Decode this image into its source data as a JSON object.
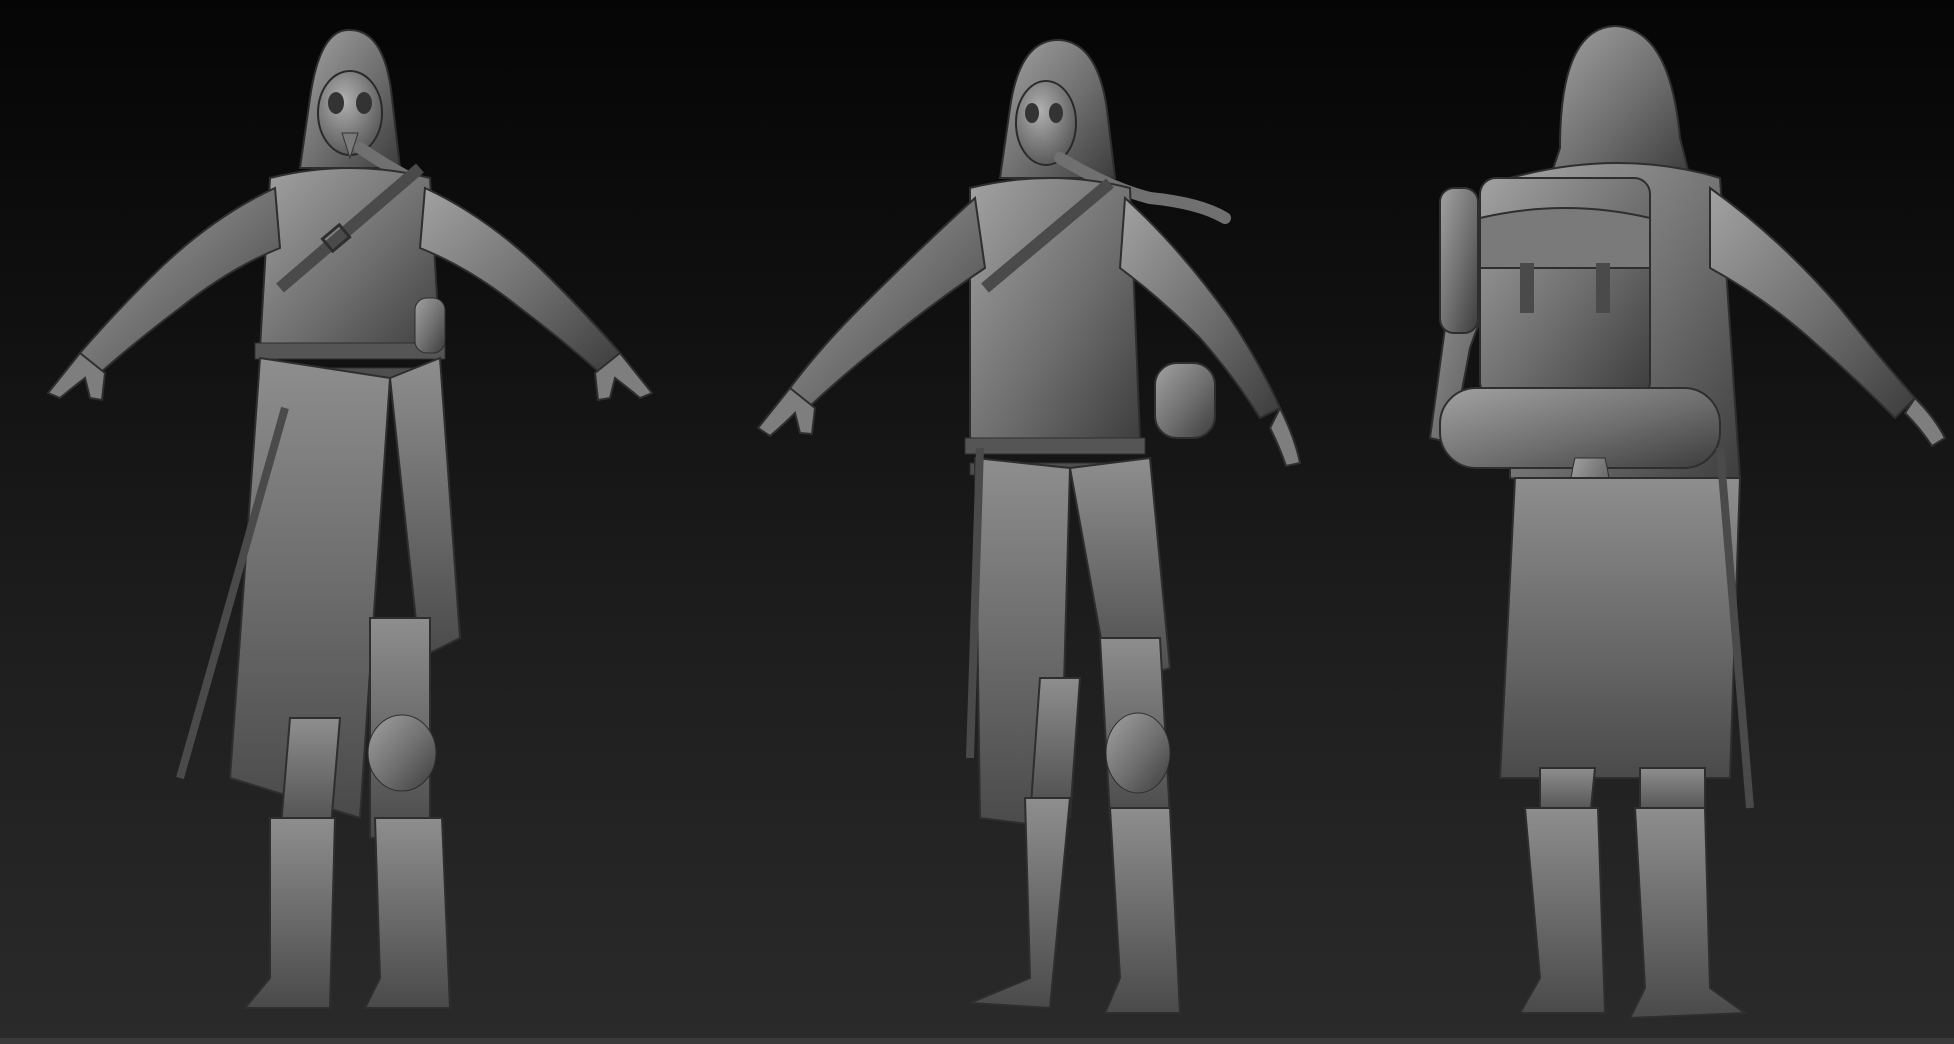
{
  "viewport": {
    "background_top": "#050505",
    "background_bottom": "#2a2a2a",
    "clay_light": "#9a9a9a",
    "clay_mid": "#6a6a6a",
    "clay_dark": "#3a3a3a"
  },
  "figures": [
    {
      "view": "front",
      "icon": "character-sculpt-front"
    },
    {
      "view": "three-quarter",
      "icon": "character-sculpt-three-quarter"
    },
    {
      "view": "back",
      "icon": "character-sculpt-back"
    }
  ]
}
